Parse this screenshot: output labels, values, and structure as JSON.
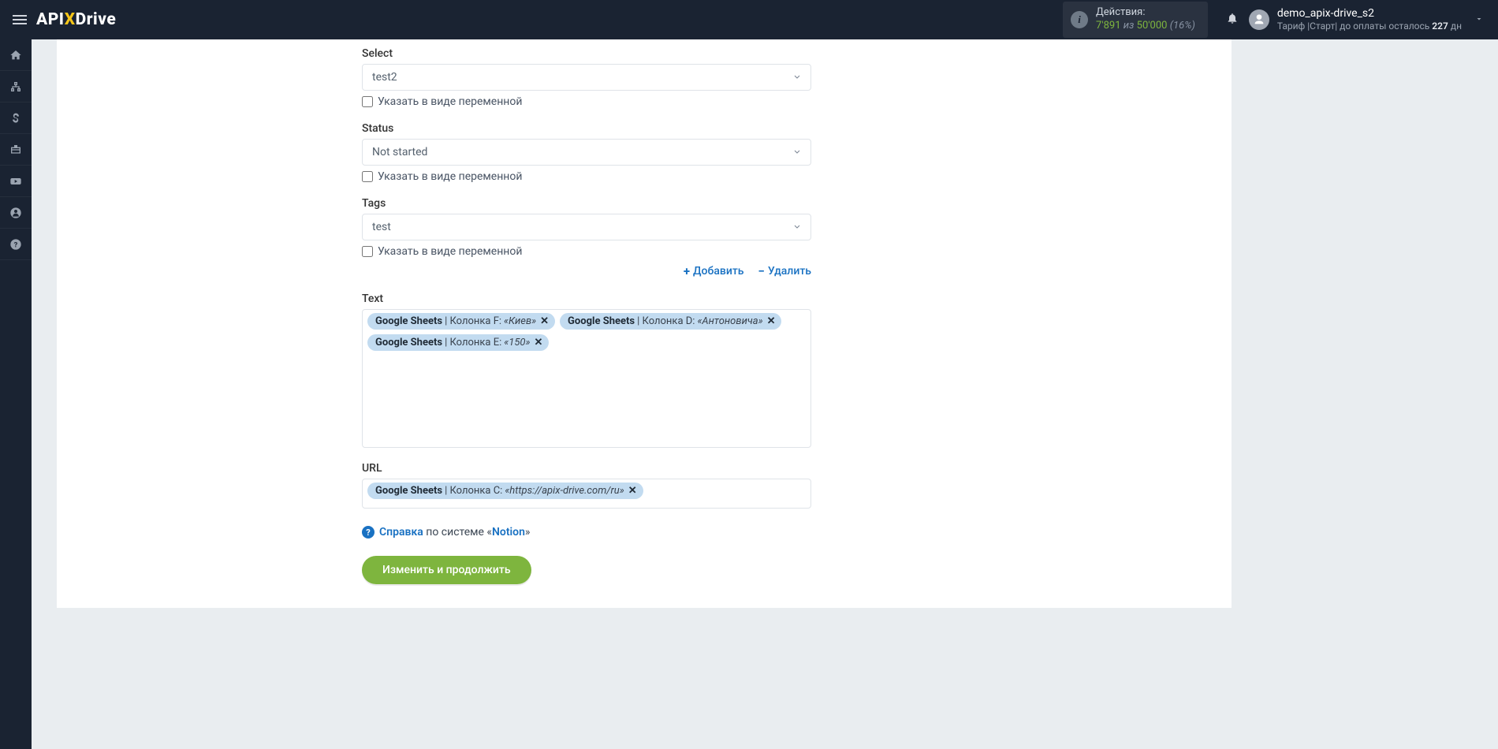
{
  "header": {
    "logo": {
      "pre": "API",
      "x": "X",
      "post": "Drive"
    },
    "actions": {
      "label": "Действия:",
      "count": "7'891",
      "of": "из",
      "max": "50'000",
      "pct": "(16%)"
    },
    "user": {
      "name": "demo_apix-drive_s2",
      "tariffPrefix": "Тариф |",
      "tariffName": "Старт",
      "tariffMid": "| до оплаты осталось ",
      "days": "227",
      "daysSuffix": " дн"
    }
  },
  "form": {
    "select": {
      "label": "Select",
      "value": "test2",
      "checkbox": "Указать в виде переменной"
    },
    "status": {
      "label": "Status",
      "value": "Not started",
      "checkbox": "Указать в виде переменной"
    },
    "tags": {
      "label": "Tags",
      "value": "test",
      "checkbox": "Указать в виде переменной",
      "add": "Добавить",
      "remove": "Удалить"
    },
    "text": {
      "label": "Text",
      "chips": [
        {
          "src": "Google Sheets",
          "col": " | Колонка F: ",
          "val": "«Киев»"
        },
        {
          "src": "Google Sheets",
          "col": " | Колонка D: ",
          "val": "«Антоновича»"
        },
        {
          "src": "Google Sheets",
          "col": " | Колонка E: ",
          "val": "«150»"
        }
      ]
    },
    "url": {
      "label": "URL",
      "chip": {
        "src": "Google Sheets",
        "col": " | Колонка C: ",
        "val": "«https://apix-drive.com/ru»"
      }
    },
    "help": {
      "word": "Справка",
      "mid": " по системе «",
      "system": "Notion",
      "post": "»"
    },
    "submit": "Изменить и продолжить"
  }
}
